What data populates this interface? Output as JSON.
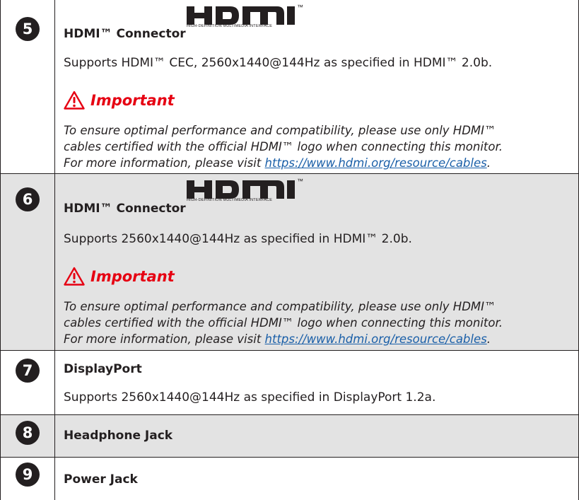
{
  "rows": [
    {
      "number": "5",
      "title": "HDMI™ Connector",
      "logo": {
        "wordmark": "HDMI",
        "tm": "™",
        "tagline": "HIGH-DEFINITION MULTIMEDIA INTERFACE"
      },
      "description": "Supports HDMI™ CEC, 2560x1440@144Hz as specified in HDMI™ 2.0b.",
      "important_label": "Important",
      "note_line1": "To ensure optimal performance and compatibility, please use only HDMI™",
      "note_line2": "cables certified with the official HDMI™ logo when connecting this monitor.",
      "note_line3_prefix": "For more information, please visit ",
      "note_link": "https://www.hdmi.org/resource/cables",
      "note_line3_suffix": "."
    },
    {
      "number": "6",
      "title": "HDMI™ Connector",
      "logo": {
        "wordmark": "HDMI",
        "tm": "™",
        "tagline": "HIGH-DEFINITION MULTIMEDIA INTERFACE"
      },
      "description": "Supports 2560x1440@144Hz as specified in HDMI™ 2.0b.",
      "important_label": "Important",
      "note_line1": "To ensure optimal performance and compatibility, please use only HDMI™",
      "note_line2": "cables certified with the official HDMI™ logo when connecting this monitor.",
      "note_line3_prefix": "For more information, please visit ",
      "note_link": "https://www.hdmi.org/resource/cables",
      "note_line3_suffix": "."
    },
    {
      "number": "7",
      "title": "DisplayPort",
      "description": "Supports 2560x1440@144Hz as specified in DisplayPort 1.2a."
    },
    {
      "number": "8",
      "title": "Headphone Jack"
    },
    {
      "number": "9",
      "title": "Power Jack"
    }
  ],
  "colors": {
    "important_red": "#e60012",
    "link_blue": "#1a5fa8",
    "shade_gray": "#e3e3e3",
    "text_dark": "#231f20"
  },
  "icons": {
    "important": "warning-triangle-icon"
  }
}
